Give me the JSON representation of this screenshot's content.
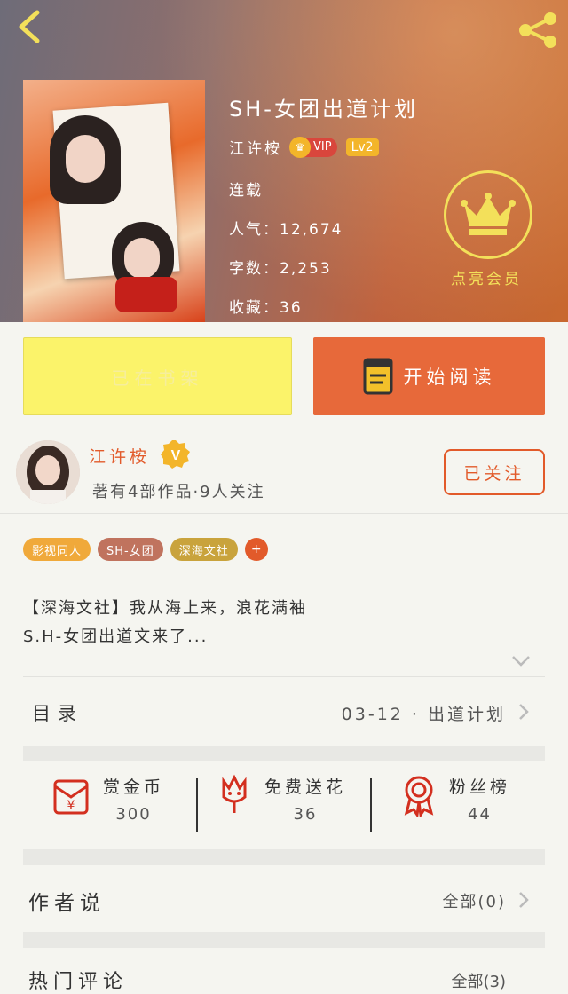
{
  "header": {
    "title": "SH-女团出道计划",
    "author": "江许桉",
    "vip_label": "VIP",
    "level": "Lv2",
    "status": "连载",
    "popularity": "人气：12,674",
    "word_count": "字数：2,253",
    "collections": "收藏：36",
    "member_label": "点亮会员"
  },
  "actions": {
    "shelf_label": "已在书架",
    "read_label": "开始阅读"
  },
  "author_card": {
    "name": "江许桉",
    "badge": "V",
    "summary": "著有4部作品·9人关注",
    "follow_label": "已关注"
  },
  "tags": [
    {
      "label": "影视同人",
      "color": "#f0a93a"
    },
    {
      "label": "SH-女团",
      "color": "#c0735e"
    },
    {
      "label": "深海文社",
      "color": "#c9a33c"
    }
  ],
  "tag_add": "+",
  "description": {
    "line1": "【深海文社】我从海上来，浪花满袖",
    "line2": "S.H-女团出道文来了..."
  },
  "toc": {
    "label": "目录",
    "latest": "03-12 · 出道计划"
  },
  "stats": [
    {
      "label": "赏金币",
      "value": "300",
      "icon": "red-envelope-coin-icon"
    },
    {
      "label": "免费送花",
      "value": "36",
      "icon": "flower-icon"
    },
    {
      "label": "粉丝榜",
      "value": "44",
      "icon": "ribbon-medal-icon"
    }
  ],
  "author_say": {
    "label": "作者说",
    "all": "全部(0)"
  },
  "next_section": {
    "label": "热门评论",
    "right": "全部(3)"
  },
  "colors": {
    "accent": "#e25a2a",
    "shelf_bg": "#fbf36a",
    "read_bg": "#e7693a",
    "member_gold": "#f3e05a"
  }
}
